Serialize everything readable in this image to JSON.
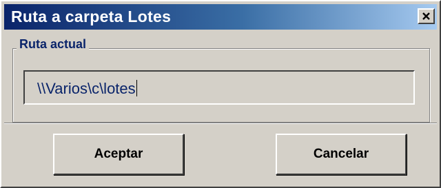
{
  "window": {
    "title": "Ruta a carpeta Lotes",
    "close_icon": "close-icon"
  },
  "group": {
    "label": "Ruta actual",
    "path_value": "\\\\Varios\\c\\lotes"
  },
  "buttons": {
    "accept_label": "Aceptar",
    "cancel_label": "Cancelar"
  },
  "colors": {
    "titlebar_start": "#0a246a",
    "titlebar_end": "#a6caf0",
    "dialog_face": "#d4d0c8",
    "accent_text": "#0a246a"
  }
}
